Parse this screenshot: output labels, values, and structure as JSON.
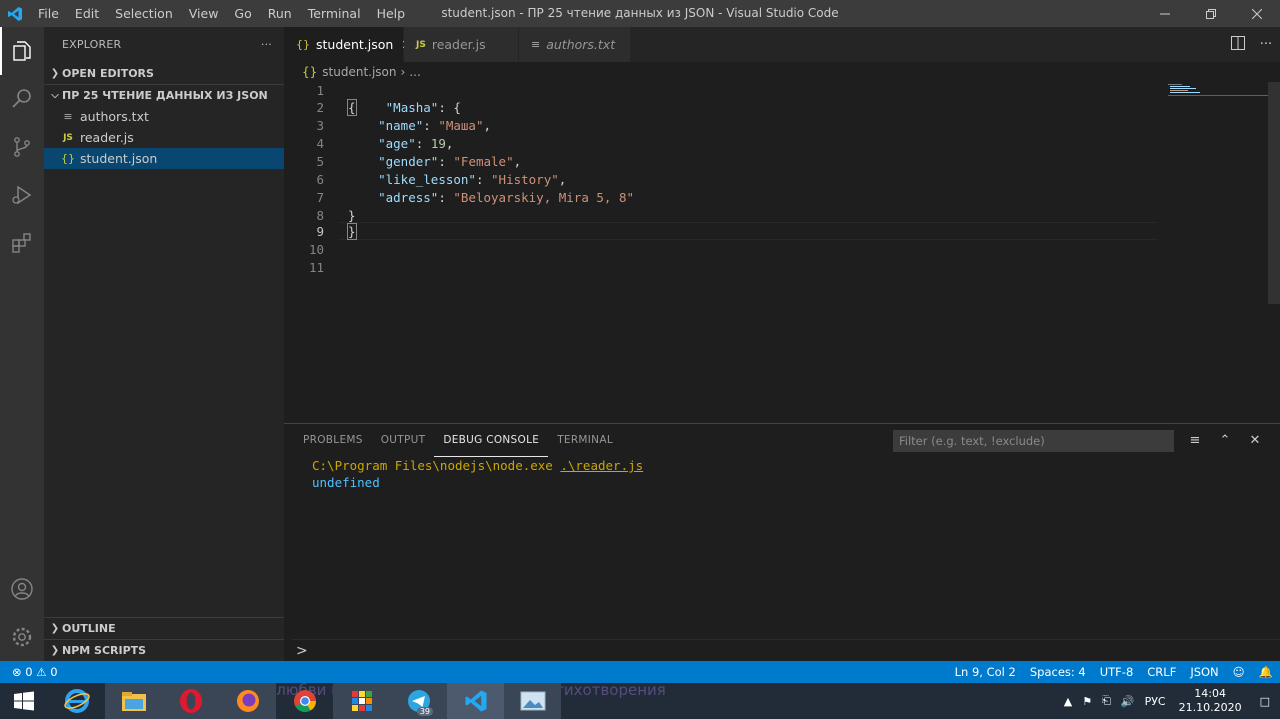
{
  "window": {
    "title": "student.json - ПР 25 чтение данных из JSON - Visual Studio Code",
    "menu": [
      "File",
      "Edit",
      "Selection",
      "View",
      "Go",
      "Run",
      "Terminal",
      "Help"
    ]
  },
  "sidebar": {
    "header": "EXPLORER",
    "open_editors": "OPEN EDITORS",
    "folder": "ПР 25 ЧТЕНИЕ ДАННЫХ ИЗ JSON",
    "files": [
      {
        "name": "authors.txt",
        "icon": "text-file-icon"
      },
      {
        "name": "reader.js",
        "icon": "js-file-icon"
      },
      {
        "name": "student.json",
        "icon": "json-file-icon"
      }
    ],
    "outline": "OUTLINE",
    "npm_scripts": "NPM SCRIPTS"
  },
  "tabs": [
    {
      "label": "student.json",
      "active": true
    },
    {
      "label": "reader.js",
      "active": false
    },
    {
      "label": "authors.txt",
      "active": false
    }
  ],
  "breadcrumb": {
    "file": "student.json",
    "more": "..."
  },
  "editor": {
    "line_numbers": [
      "1",
      "2",
      "3",
      "4",
      "5",
      "6",
      "7",
      "8",
      "9",
      "10",
      "11"
    ],
    "current_line": 9
  },
  "panel": {
    "tabs": [
      "PROBLEMS",
      "OUTPUT",
      "DEBUG CONSOLE",
      "TERMINAL"
    ],
    "active_tab": "DEBUG CONSOLE",
    "filter_placeholder": "Filter (e.g. text, !exclude)",
    "console_path": "C:\\Program Files\\nodejs\\node.exe",
    "console_link": ".\\reader.js",
    "console_output": "undefined",
    "prompt": ">"
  },
  "statusbar": {
    "errors": "0",
    "warnings": "0",
    "position": "Ln 9, Col 2",
    "spaces": "Spaces: 4",
    "encoding": "UTF-8",
    "eol": "CRLF",
    "language": "JSON"
  },
  "taskbar": {
    "background_text": "Стихи о любви классиков. Читать лучшие стихотворения",
    "telegram_badge": "39",
    "lang": "РУС",
    "time": "14:04",
    "date": "21.10.2020"
  },
  "colors": {
    "accent": "#007acc",
    "selection": "#094771"
  }
}
